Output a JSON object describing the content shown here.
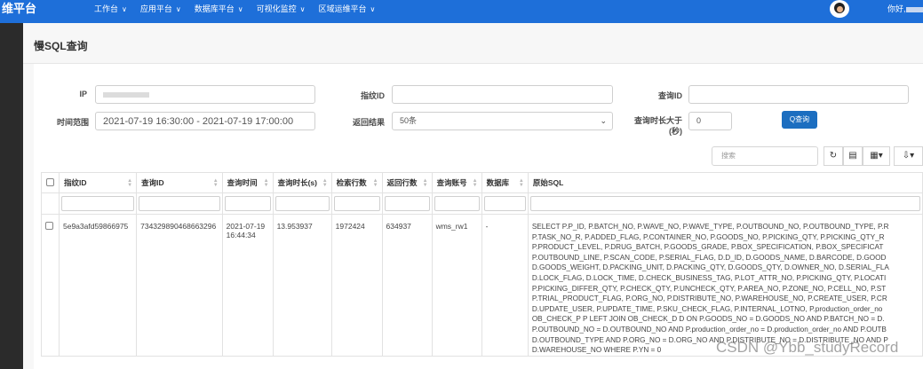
{
  "app": {
    "brand": "维平台"
  },
  "nav": [
    {
      "label": "工作台"
    },
    {
      "label": "应用平台"
    },
    {
      "label": "数据库平台"
    },
    {
      "label": "可视化监控"
    },
    {
      "label": "区域运维平台"
    }
  ],
  "user": {
    "greeting": "你好,"
  },
  "page": {
    "title": "慢SQL查询"
  },
  "form": {
    "ip_label": "IP",
    "fingerprint_label": "指纹ID",
    "fingerprint_value": "",
    "query_id_label": "查询ID",
    "query_id_value": "",
    "time_range_label": "时间范围",
    "time_range_value": "2021-07-19 16:30:00 - 2021-07-19 17:00:00",
    "result_label": "返回结果",
    "result_value": "50条",
    "duration_label_1": "查询时长大于",
    "duration_label_2": "(秒)",
    "duration_value": "0",
    "query_button": "Q查询"
  },
  "toolbar": {
    "search_placeholder": "搜索",
    "refresh_icon": "refresh-icon",
    "toggle_icon": "toggle-view-icon",
    "columns_icon": "columns-icon",
    "export_icon": "export-icon"
  },
  "table": {
    "headers": [
      "指纹ID",
      "查询ID",
      "查询时间",
      "查询时长(s)",
      "检索行数",
      "返回行数",
      "查询账号",
      "数据库",
      "原始SQL"
    ],
    "rows": [
      {
        "fingerprint_id": "5e9a3afd59866975",
        "query_id": "734329890468663296",
        "query_time_1": "2021-07-19",
        "query_time_2": "16:44:34",
        "duration": "13.953937",
        "rows_examined": "1972424",
        "rows_sent": "634937",
        "account": "wms_rw1",
        "database": "-",
        "sql_lines": [
          "SELECT P.P_ID, P.BATCH_NO, P.WAVE_NO, P.WAVE_TYPE, P.OUTBOUND_NO, P.OUTBOUND_TYPE, P.R",
          "P.TASK_NO_R, P.ADDED_FLAG, P.CONTAINER_NO, P.GOODS_NO, P.PICKING_QTY, P.PICKING_QTY_R",
          "P.PRODUCT_LEVEL, P.DRUG_BATCH, P.GOODS_GRADE, P.BOX_SPECIFICATION, P.BOX_SPECIFICAT",
          "P.OUTBOUND_LINE, P.SCAN_CODE, P.SERIAL_FLAG, D.D_ID, D.GOODS_NAME, D.BARCODE, D.GOOD",
          "D.GOODS_WEIGHT, D.PACKING_UNIT, D.PACKING_QTY, D.GOODS_QTY, D.OWNER_NO, D.SERIAL_FLA",
          "D.LOCK_FLAG, D.LOCK_TIME, D.CHECK_BUSINESS_TAG, P.LOT_ATTR_NO, P.PICKING_QTY, P.LOCATI",
          "P.PICKING_DIFFER_QTY, P.CHECK_QTY, P.UNCHECK_QTY, P.AREA_NO, P.ZONE_NO, P.CELL_NO, P.ST",
          "P.TRIAL_PRODUCT_FLAG, P.ORG_NO, P.DISTRIBUTE_NO, P.WAREHOUSE_NO, P.CREATE_USER, P.CR",
          "D.UPDATE_USER, P.UPDATE_TIME, P.SKU_CHECK_FLAG, P.INTERNAL_LOTNO, P.production_order_no",
          "OB_CHECK_P P LEFT JOIN OB_CHECK_D D ON P.GOODS_NO = D.GOODS_NO AND P.BATCH_NO = D.",
          "P.OUTBOUND_NO = D.OUTBOUND_NO AND P.production_order_no = D.production_order_no AND P.OUTB",
          "D.OUTBOUND_TYPE AND P.ORG_NO = D.ORG_NO AND P.DISTRIBUTE_NO = D.DISTRIBUTE_NO AND P",
          "D.WAREHOUSE_NO WHERE P.YN = 0"
        ]
      }
    ]
  },
  "watermark": "CSDN @Ybb_studyRecord"
}
